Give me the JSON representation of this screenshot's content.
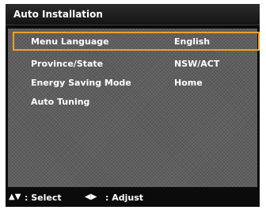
{
  "title": "Auto Installation",
  "menu": [
    {
      "label": "Menu Language",
      "value": "English"
    },
    {
      "label": "Province/State",
      "value": "NSW/ACT"
    },
    {
      "label": "Energy Saving Mode",
      "value": "Home"
    },
    {
      "label": "Auto Tuning",
      "value": ""
    }
  ],
  "footer": {
    "select_icon": "up-down-arrows-icon",
    "select_label": ": Select",
    "adjust_icon": "left-right-arrows-icon",
    "adjust_label": ": Adjust"
  },
  "colors": {
    "highlight": "#f0a024",
    "panel": "#5e5e5e",
    "frame": "#0b0b0b"
  }
}
